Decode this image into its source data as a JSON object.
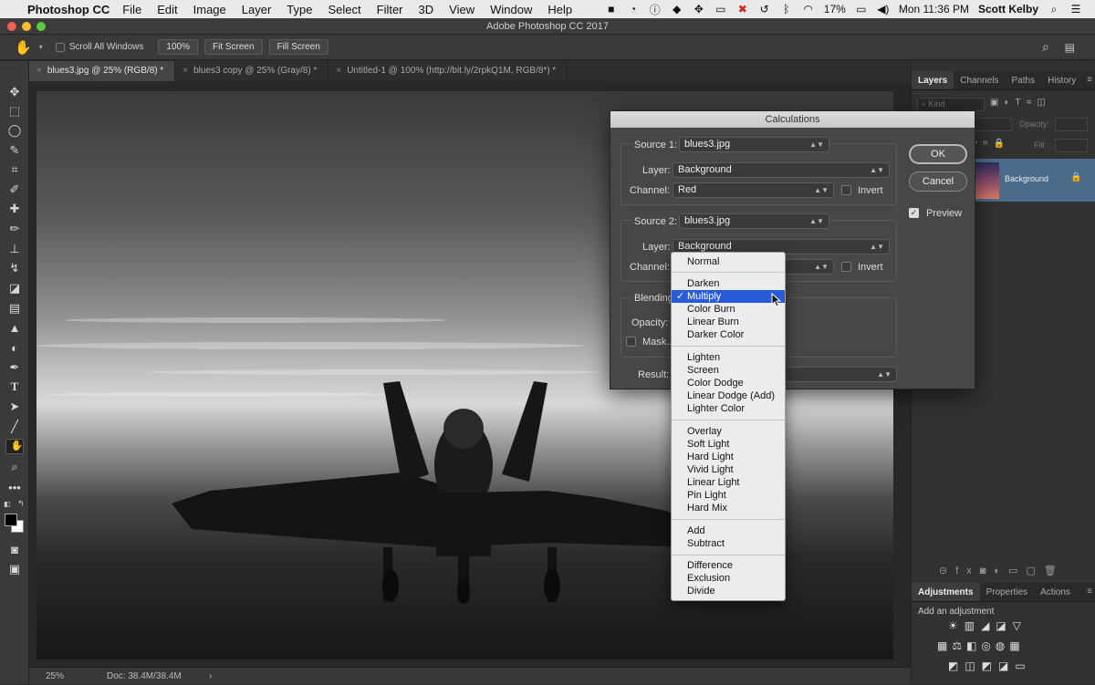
{
  "menubar": {
    "app_name": "Photoshop CC",
    "items": [
      "File",
      "Edit",
      "Image",
      "Layer",
      "Type",
      "Select",
      "Filter",
      "3D",
      "View",
      "Window",
      "Help"
    ],
    "battery": "17%",
    "clock": "Mon 11:36 PM",
    "user": "Scott Kelby"
  },
  "window_title": "Adobe Photoshop CC 2017",
  "options": {
    "scroll_all_windows": "Scroll All Windows",
    "zoom_100": "100%",
    "fit_screen": "Fit Screen",
    "fill_screen": "Fill Screen"
  },
  "doc_tabs": [
    "blues3.jpg @ 25% (RGB/8) *",
    "blues3 copy @ 25% (Gray/8) *",
    "Untitled-1 @ 100% (http://bit.ly/2rpkQ1M, RGB/8*) *"
  ],
  "status": {
    "zoom": "25%",
    "doc": "Doc: 38.4M/38.4M",
    "arrow": "›"
  },
  "layers_panel": {
    "tabs": [
      "Layers",
      "Channels",
      "Paths",
      "History"
    ],
    "kind_placeholder": "Kind",
    "opacity_label": "Opacity:",
    "fill_label": "Fill:",
    "layer_name": "Background"
  },
  "adjust_panel": {
    "tabs": [
      "Adjustments",
      "Properties",
      "Actions"
    ],
    "hint": "Add an adjustment"
  },
  "dialog": {
    "title": "Calculations",
    "source1_label": "Source 1:",
    "source1_value": "blues3.jpg",
    "layer_label": "Layer:",
    "layer1_value": "Background",
    "channel_label": "Channel:",
    "channel1_value": "Red",
    "invert_label": "Invert",
    "source2_label": "Source 2:",
    "source2_value": "blues3.jpg",
    "layer2_value": "Background",
    "blending_label": "Blending",
    "opacity_label": "Opacity:",
    "mask_label": "Mask...",
    "result_label": "Result:",
    "ok_label": "OK",
    "cancel_label": "Cancel",
    "preview_label": "Preview"
  },
  "blend_menu": {
    "groups": [
      [
        "Normal"
      ],
      [
        "Darken",
        "Multiply",
        "Color Burn",
        "Linear Burn",
        "Darker Color"
      ],
      [
        "Lighten",
        "Screen",
        "Color Dodge",
        "Linear Dodge (Add)",
        "Lighter Color"
      ],
      [
        "Overlay",
        "Soft Light",
        "Hard Light",
        "Vivid Light",
        "Linear Light",
        "Pin Light",
        "Hard Mix"
      ],
      [
        "Add",
        "Subtract"
      ],
      [
        "Difference",
        "Exclusion",
        "Divide"
      ]
    ],
    "selected": "Multiply"
  }
}
